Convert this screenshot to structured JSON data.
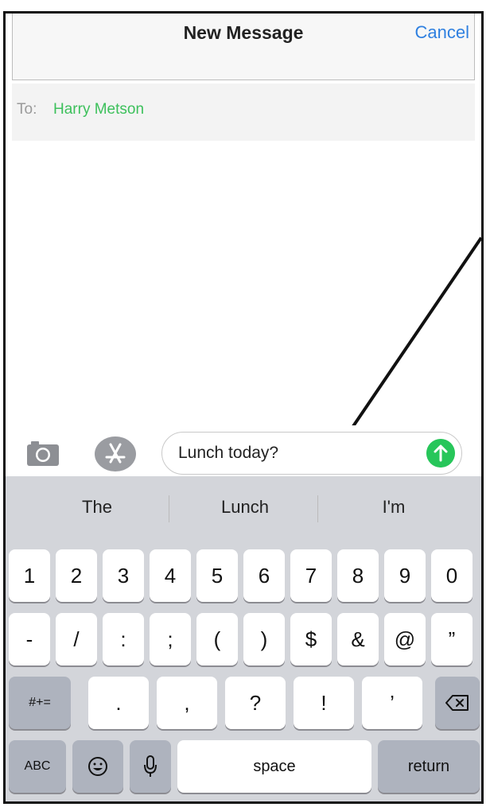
{
  "nav": {
    "title": "New Message",
    "cancel_label": "Cancel"
  },
  "to": {
    "label": "To:",
    "recipient": "Harry Metson"
  },
  "compose": {
    "message_text": "Lunch today?"
  },
  "suggestions": [
    "The",
    "Lunch",
    "I'm"
  ],
  "keys": {
    "row1": [
      "1",
      "2",
      "3",
      "4",
      "5",
      "6",
      "7",
      "8",
      "9",
      "0"
    ],
    "row2": [
      "-",
      "/",
      ":",
      ";",
      "(",
      ")",
      "$",
      "&",
      "@",
      "”"
    ],
    "row3_shift": "#+=",
    "row3": [
      ".",
      ",",
      "?",
      "!",
      "’"
    ],
    "abc": "ABC",
    "space": "space",
    "return": "return"
  },
  "colors": {
    "accent_blue": "#2f80e0",
    "recipient_green": "#3cc05b",
    "send_green": "#27c65a"
  },
  "icons": [
    "camera-icon",
    "app-store-icon",
    "send-arrow-icon",
    "backspace-icon",
    "emoji-icon",
    "microphone-icon"
  ]
}
